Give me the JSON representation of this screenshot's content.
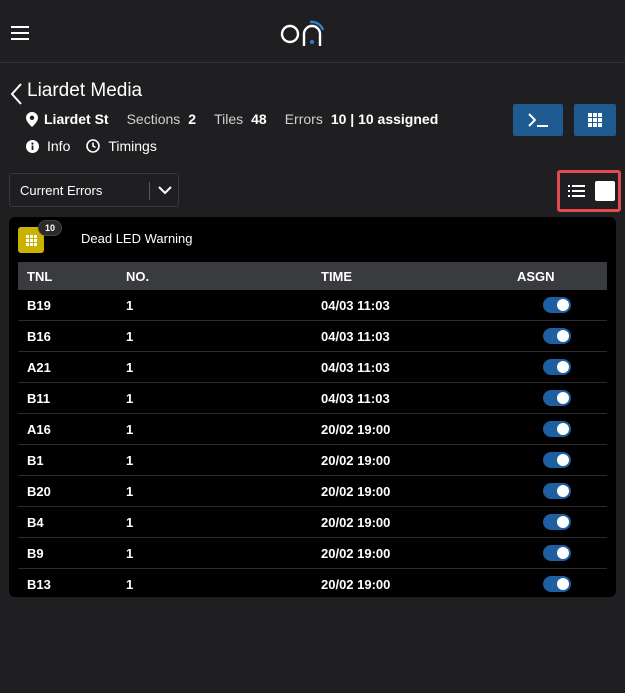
{
  "topbar": {
    "menu_icon": "hamburger-icon",
    "logo_text": "on"
  },
  "header": {
    "back_icon": "chevron-left-icon",
    "title": "Liardet Media",
    "location": "Liardet St",
    "sections_label": "Sections",
    "sections_value": "2",
    "tiles_label": "Tiles",
    "tiles_value": "48",
    "errors_label": "Errors",
    "errors_value": "10 | 10 assigned",
    "info_label": "Info",
    "timings_label": "Timings"
  },
  "toolbar": {
    "terminal_icon": "terminal-icon",
    "grid_icon": "grid-icon",
    "filter_value": "Current Errors",
    "list_view_icon": "list-icon"
  },
  "group": {
    "icon": "grid-icon",
    "count": "10",
    "title": "Dead LED Warning"
  },
  "table": {
    "columns": [
      "TNL",
      "NO.",
      "TIME",
      "ASGN"
    ],
    "rows": [
      {
        "tnl": "B19",
        "no": "1",
        "time": "04/03 11:03",
        "asgn": true
      },
      {
        "tnl": "B16",
        "no": "1",
        "time": "04/03 11:03",
        "asgn": true
      },
      {
        "tnl": "A21",
        "no": "1",
        "time": "04/03 11:03",
        "asgn": true
      },
      {
        "tnl": "B11",
        "no": "1",
        "time": "04/03 11:03",
        "asgn": true
      },
      {
        "tnl": "A16",
        "no": "1",
        "time": "20/02 19:00",
        "asgn": true
      },
      {
        "tnl": "B1",
        "no": "1",
        "time": "20/02 19:00",
        "asgn": true
      },
      {
        "tnl": "B20",
        "no": "1",
        "time": "20/02 19:00",
        "asgn": true
      },
      {
        "tnl": "B4",
        "no": "1",
        "time": "20/02 19:00",
        "asgn": true
      },
      {
        "tnl": "B9",
        "no": "1",
        "time": "20/02 19:00",
        "asgn": true
      },
      {
        "tnl": "B13",
        "no": "1",
        "time": "20/02 19:00",
        "asgn": true
      }
    ]
  },
  "colors": {
    "background": "#1f1f21",
    "card": "#000000",
    "accent_blue": "#1d5b90",
    "highlight": "#e5484d",
    "badge_yellow": "#c9b300"
  }
}
